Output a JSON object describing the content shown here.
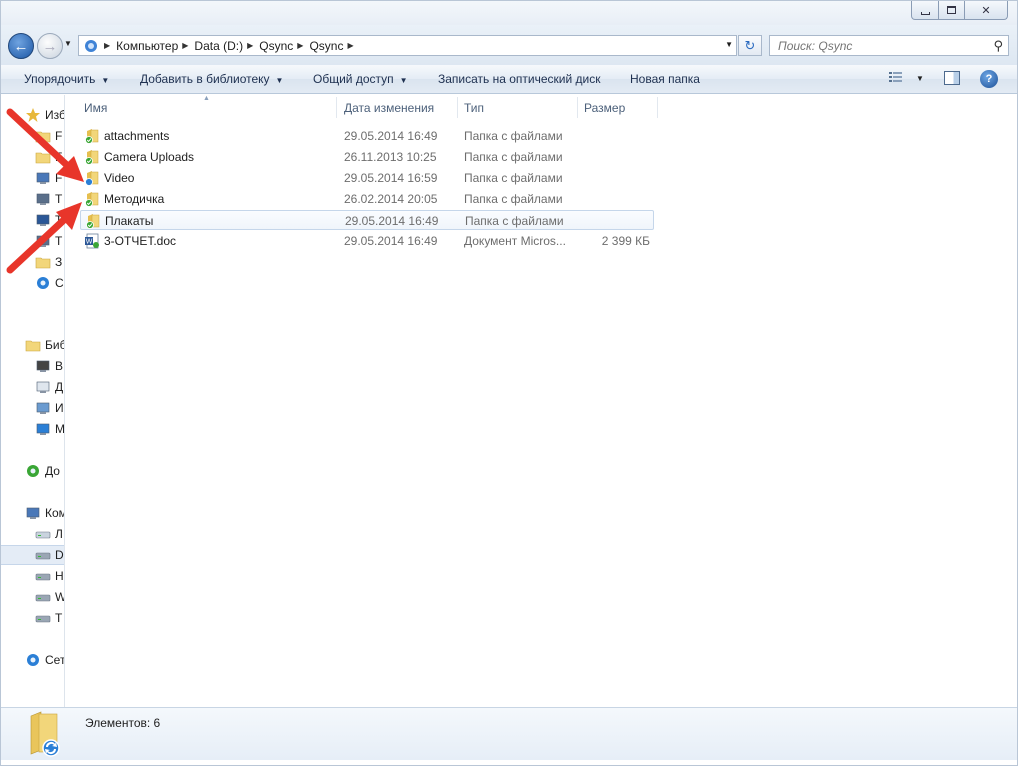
{
  "window": {
    "controls": {
      "minimize": "▭",
      "maximize": "⧉",
      "close": "✕"
    }
  },
  "address": {
    "crumbs": [
      "Компьютер",
      "Data (D:)",
      "Qsync",
      "Qsync"
    ]
  },
  "search": {
    "placeholder": "Поиск: Qsync"
  },
  "toolbar": {
    "organize": "Упорядочить",
    "add_to_library": "Добавить в библиотеку",
    "share": "Общий доступ",
    "burn": "Записать на оптический диск",
    "new_folder": "Новая папка",
    "help": "?"
  },
  "columns": {
    "name": "Имя",
    "date": "Дата изменения",
    "type": "Тип",
    "size": "Размер"
  },
  "files": [
    {
      "name": "attachments",
      "date": "29.05.2014 16:49",
      "type": "Папка с файлами",
      "size": "",
      "icon": "synced-folder-icon"
    },
    {
      "name": "Camera Uploads",
      "date": "26.11.2013 10:25",
      "type": "Папка с файлами",
      "size": "",
      "icon": "synced-folder-icon"
    },
    {
      "name": "Video",
      "date": "29.05.2014 16:59",
      "type": "Папка с файлами",
      "size": "",
      "icon": "syncing-folder-icon"
    },
    {
      "name": "Методичка",
      "date": "26.02.2014 20:05",
      "type": "Папка с файлами",
      "size": "",
      "icon": "synced-folder-icon"
    },
    {
      "name": "Плакаты",
      "date": "29.05.2014 16:49",
      "type": "Папка с файлами",
      "size": "",
      "icon": "synced-folder-icon",
      "selected": true
    },
    {
      "name": "3-ОТЧЕТ.doc",
      "date": "29.05.2014 16:49",
      "type": "Документ Micros...",
      "size": "2 399 КБ",
      "icon": "word-doc-icon"
    }
  ],
  "nav": {
    "items": [
      {
        "label": "Изб",
        "icon": "favorites-star-icon",
        "level": "top"
      },
      {
        "label": "F",
        "icon": "folder-icon"
      },
      {
        "label": "F",
        "icon": "folder-icon"
      },
      {
        "label": "F",
        "icon": "computer-icon"
      },
      {
        "label": "T",
        "icon": "network-drive-icon"
      },
      {
        "label": "T",
        "icon": "desktop-icon"
      },
      {
        "label": "T",
        "icon": "network-drive-icon"
      },
      {
        "label": "З",
        "icon": "downloads-folder-icon"
      },
      {
        "label": "C",
        "icon": "sync-icon"
      },
      {
        "label": "Биб",
        "icon": "libraries-icon",
        "level": "top"
      },
      {
        "label": "В",
        "icon": "video-library-icon"
      },
      {
        "label": "Д",
        "icon": "documents-library-icon"
      },
      {
        "label": "И",
        "icon": "pictures-library-icon"
      },
      {
        "label": "М",
        "icon": "music-library-icon"
      },
      {
        "label": "До",
        "icon": "homegroup-icon",
        "level": "top"
      },
      {
        "label": "Ком",
        "icon": "computer-icon",
        "level": "top"
      },
      {
        "label": "Л",
        "icon": "windows-drive-icon"
      },
      {
        "label": "D",
        "icon": "drive-icon",
        "selected": true
      },
      {
        "label": "H",
        "icon": "drive-icon"
      },
      {
        "label": "W",
        "icon": "drive-icon"
      },
      {
        "label": "T",
        "icon": "drive-icon"
      },
      {
        "label": "Сет",
        "icon": "network-icon",
        "level": "top"
      }
    ]
  },
  "status": {
    "items_count": "Элементов: 6"
  },
  "colors": {
    "annotation_arrow": "#e8352a",
    "folder_yellow": "#f2cf5b",
    "sync_green": "#3aa635",
    "sync_blue": "#2b7fd6"
  }
}
